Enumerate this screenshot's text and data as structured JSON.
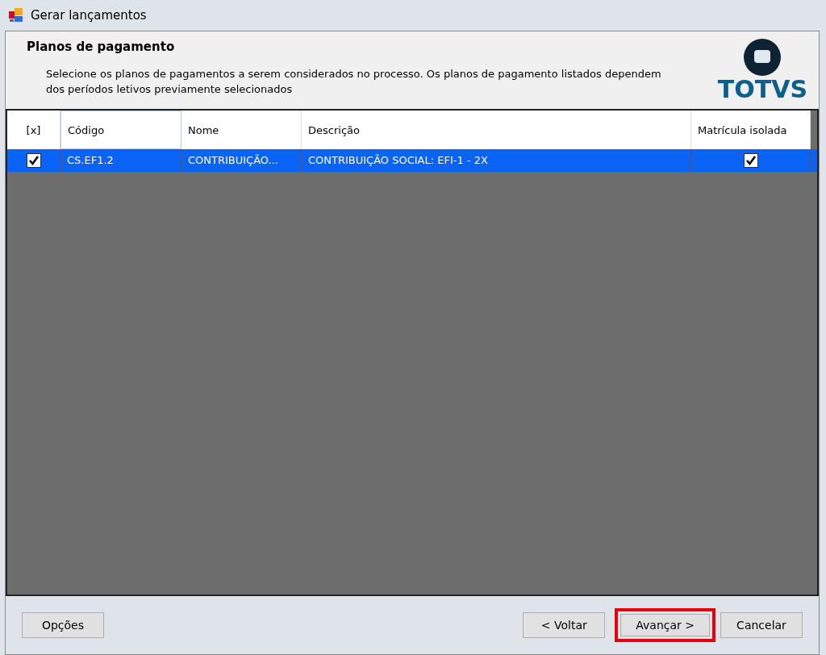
{
  "window": {
    "title": "Gerar lançamentos"
  },
  "header": {
    "title": "Planos de pagamento",
    "description": "Selecione os planos de pagamentos a serem considerados no processo. Os planos de pagamento listados dependem dos períodos letivos previamente selecionados",
    "logo_text": "TOTVS"
  },
  "table": {
    "columns": [
      {
        "label": "[x]",
        "kind": "check"
      },
      {
        "label": "Código",
        "kind": "text"
      },
      {
        "label": "Nome",
        "kind": "text"
      },
      {
        "label": "Descrição",
        "kind": "text"
      },
      {
        "label": "Matrícula isolada",
        "kind": "check"
      }
    ],
    "rows": [
      {
        "selected": true,
        "cells": [
          {
            "checked": true
          },
          {
            "text": "CS.EF1.2"
          },
          {
            "text": "CONTRIBUIÇÃO..."
          },
          {
            "text": "CONTRIBUIÇÃO SOCIAL: EFI-1 - 2X"
          },
          {
            "checked": true
          }
        ]
      }
    ]
  },
  "buttons_left": [
    {
      "label": "Opções",
      "highlighted": false
    }
  ],
  "buttons_right": [
    {
      "label": "< Voltar",
      "highlighted": false
    },
    {
      "label": "Avançar >",
      "highlighted": true
    },
    {
      "label": "Cancelar",
      "highlighted": false
    }
  ]
}
